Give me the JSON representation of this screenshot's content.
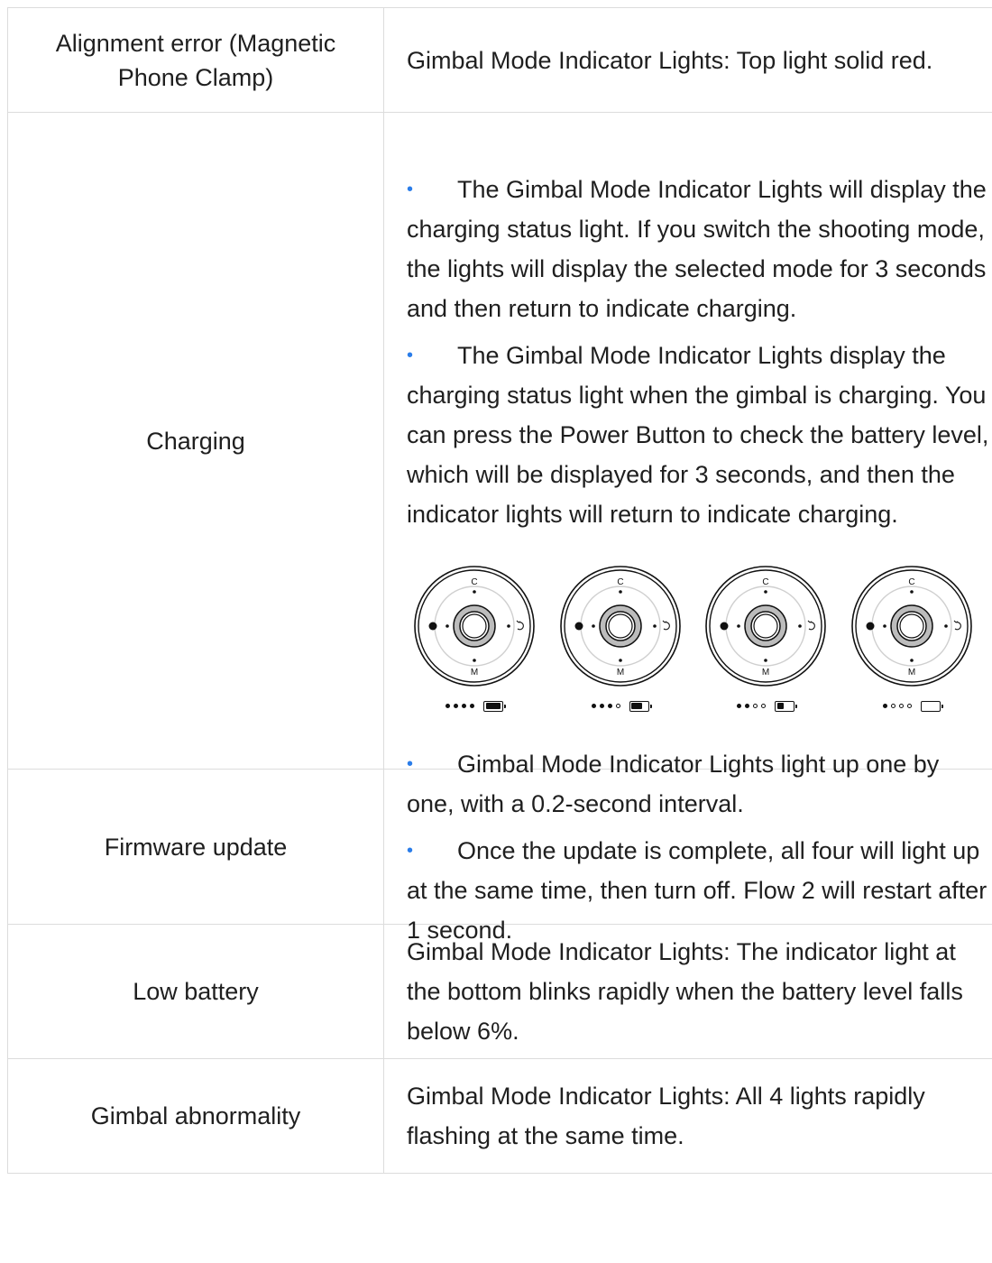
{
  "rows": [
    {
      "condition": "Alignment error (Magnetic Phone Clamp)",
      "description": "Gimbal Mode Indicator Lights: Top light solid red."
    },
    {
      "condition": "Charging",
      "bullets": [
        "The Gimbal Mode Indicator Lights will display the charging status light. If you switch the shooting mode, the lights will display the selected mode for 3 seconds and then return to indicate charging.",
        "The Gimbal Mode Indicator Lights display the charging status light when the gimbal is charging. You can press the Power Button to check the battery level, which will be displayed for 3 seconds, and then the indicator lights will return to indicate charging."
      ],
      "dial_labels": {
        "top": "C",
        "bottom": "M"
      },
      "charging_levels": [
        {
          "lights_on": 4,
          "battery_fill": 1.0
        },
        {
          "lights_on": 3,
          "battery_fill": 0.75
        },
        {
          "lights_on": 2,
          "battery_fill": 0.45
        },
        {
          "lights_on": 1,
          "battery_fill": 0.0
        }
      ]
    },
    {
      "condition": "Firmware update",
      "bullets": [
        "Gimbal Mode Indicator Lights light up one by one, with a 0.2-second interval.",
        "Once the update is complete, all four will light up at the same time, then turn off. Flow 2 will restart after 1 second."
      ]
    },
    {
      "condition": "Low battery",
      "description": "Gimbal Mode Indicator Lights: The indicator light at the bottom blinks rapidly when the battery level falls below 6%."
    },
    {
      "condition": "Gimbal abnormality",
      "description": "Gimbal Mode Indicator Lights: All 4 lights rapidly flashing at the same time."
    }
  ],
  "colors": {
    "bullet": "#2b7de9",
    "border": "#dcdcdc",
    "text": "#1f1f1f"
  },
  "icons": {
    "dial": "gimbal-mode-dial-icon",
    "battery": "battery-icon",
    "switch": "mode-switch-icon"
  }
}
